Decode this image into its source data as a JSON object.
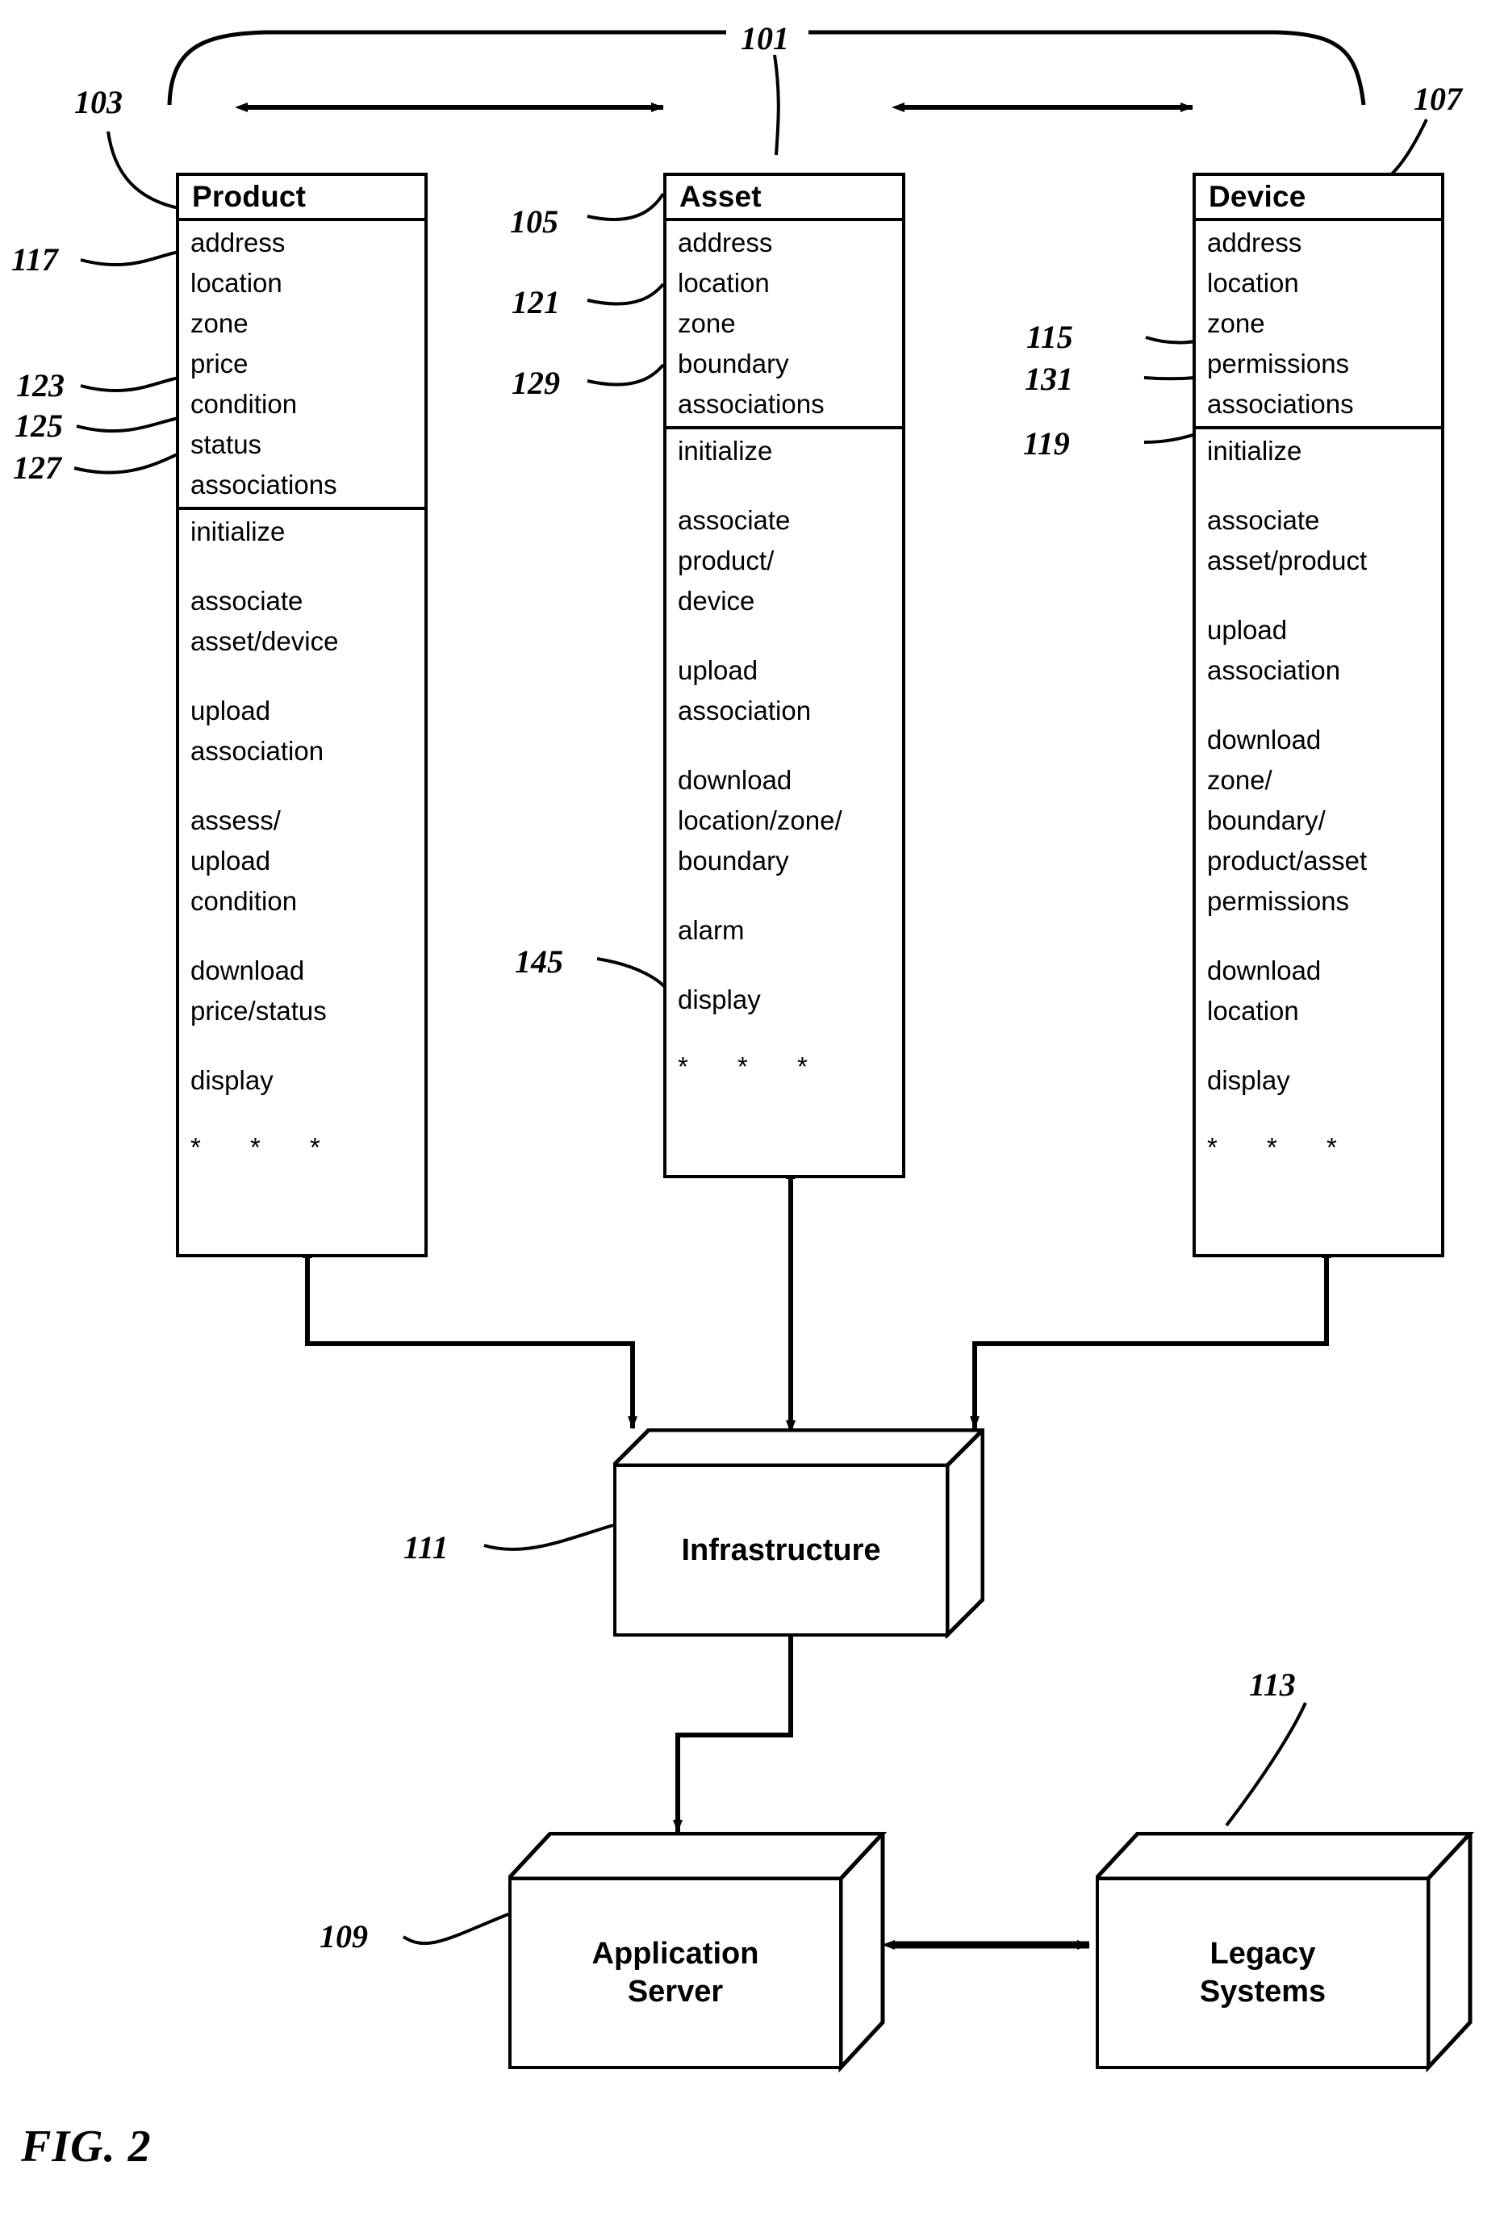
{
  "figure": {
    "caption": "FIG. 2"
  },
  "classes": [
    {
      "id": "product",
      "title": "Product",
      "attributes": [
        "address",
        "location",
        "zone",
        "price",
        "condition",
        "status",
        "associations"
      ],
      "operations": [
        [
          "initialize"
        ],
        [
          "associate",
          "asset/device"
        ],
        [
          "upload",
          "association"
        ],
        [
          "assess/",
          "upload",
          "condition"
        ],
        [
          "download",
          "price/status"
        ],
        [
          "display"
        ]
      ],
      "ellipsis": "*  *  *"
    },
    {
      "id": "asset",
      "title": "Asset",
      "attributes": [
        "address",
        "location",
        "zone",
        "boundary",
        "associations"
      ],
      "operations": [
        [
          "initialize"
        ],
        [
          "associate",
          "product/",
          "device"
        ],
        [
          "upload",
          "association"
        ],
        [
          "download",
          "location/zone/",
          "boundary"
        ],
        [
          "alarm"
        ],
        [
          "display"
        ]
      ],
      "ellipsis": "*  *  *"
    },
    {
      "id": "device",
      "title": "Device",
      "attributes": [
        "address",
        "location",
        "zone",
        "permissions",
        "associations"
      ],
      "operations": [
        [
          "initialize"
        ],
        [
          "associate",
          "asset/product"
        ],
        [
          "upload",
          "association"
        ],
        [
          "download",
          "zone/",
          "boundary/",
          "product/asset",
          "permissions"
        ],
        [
          "download",
          "location"
        ],
        [
          "display"
        ]
      ],
      "ellipsis": "*  *  *"
    }
  ],
  "nodes": [
    {
      "id": "infrastructure",
      "label": "Infrastructure"
    },
    {
      "id": "application-server",
      "label": "Application\nServer"
    },
    {
      "id": "legacy-systems",
      "label": "Legacy\nSystems"
    }
  ],
  "reference_numerals": [
    {
      "id": "101",
      "value": "101"
    },
    {
      "id": "103",
      "value": "103"
    },
    {
      "id": "105",
      "value": "105"
    },
    {
      "id": "107",
      "value": "107"
    },
    {
      "id": "109",
      "value": "109"
    },
    {
      "id": "111",
      "value": "111"
    },
    {
      "id": "113",
      "value": "113"
    },
    {
      "id": "115",
      "value": "115"
    },
    {
      "id": "117",
      "value": "117"
    },
    {
      "id": "119",
      "value": "119"
    },
    {
      "id": "121",
      "value": "121"
    },
    {
      "id": "123",
      "value": "123"
    },
    {
      "id": "125",
      "value": "125"
    },
    {
      "id": "127",
      "value": "127"
    },
    {
      "id": "129",
      "value": "129"
    },
    {
      "id": "131",
      "value": "131"
    },
    {
      "id": "145",
      "value": "145"
    }
  ],
  "colors": {
    "stroke": "#000000",
    "background": "#ffffff"
  }
}
